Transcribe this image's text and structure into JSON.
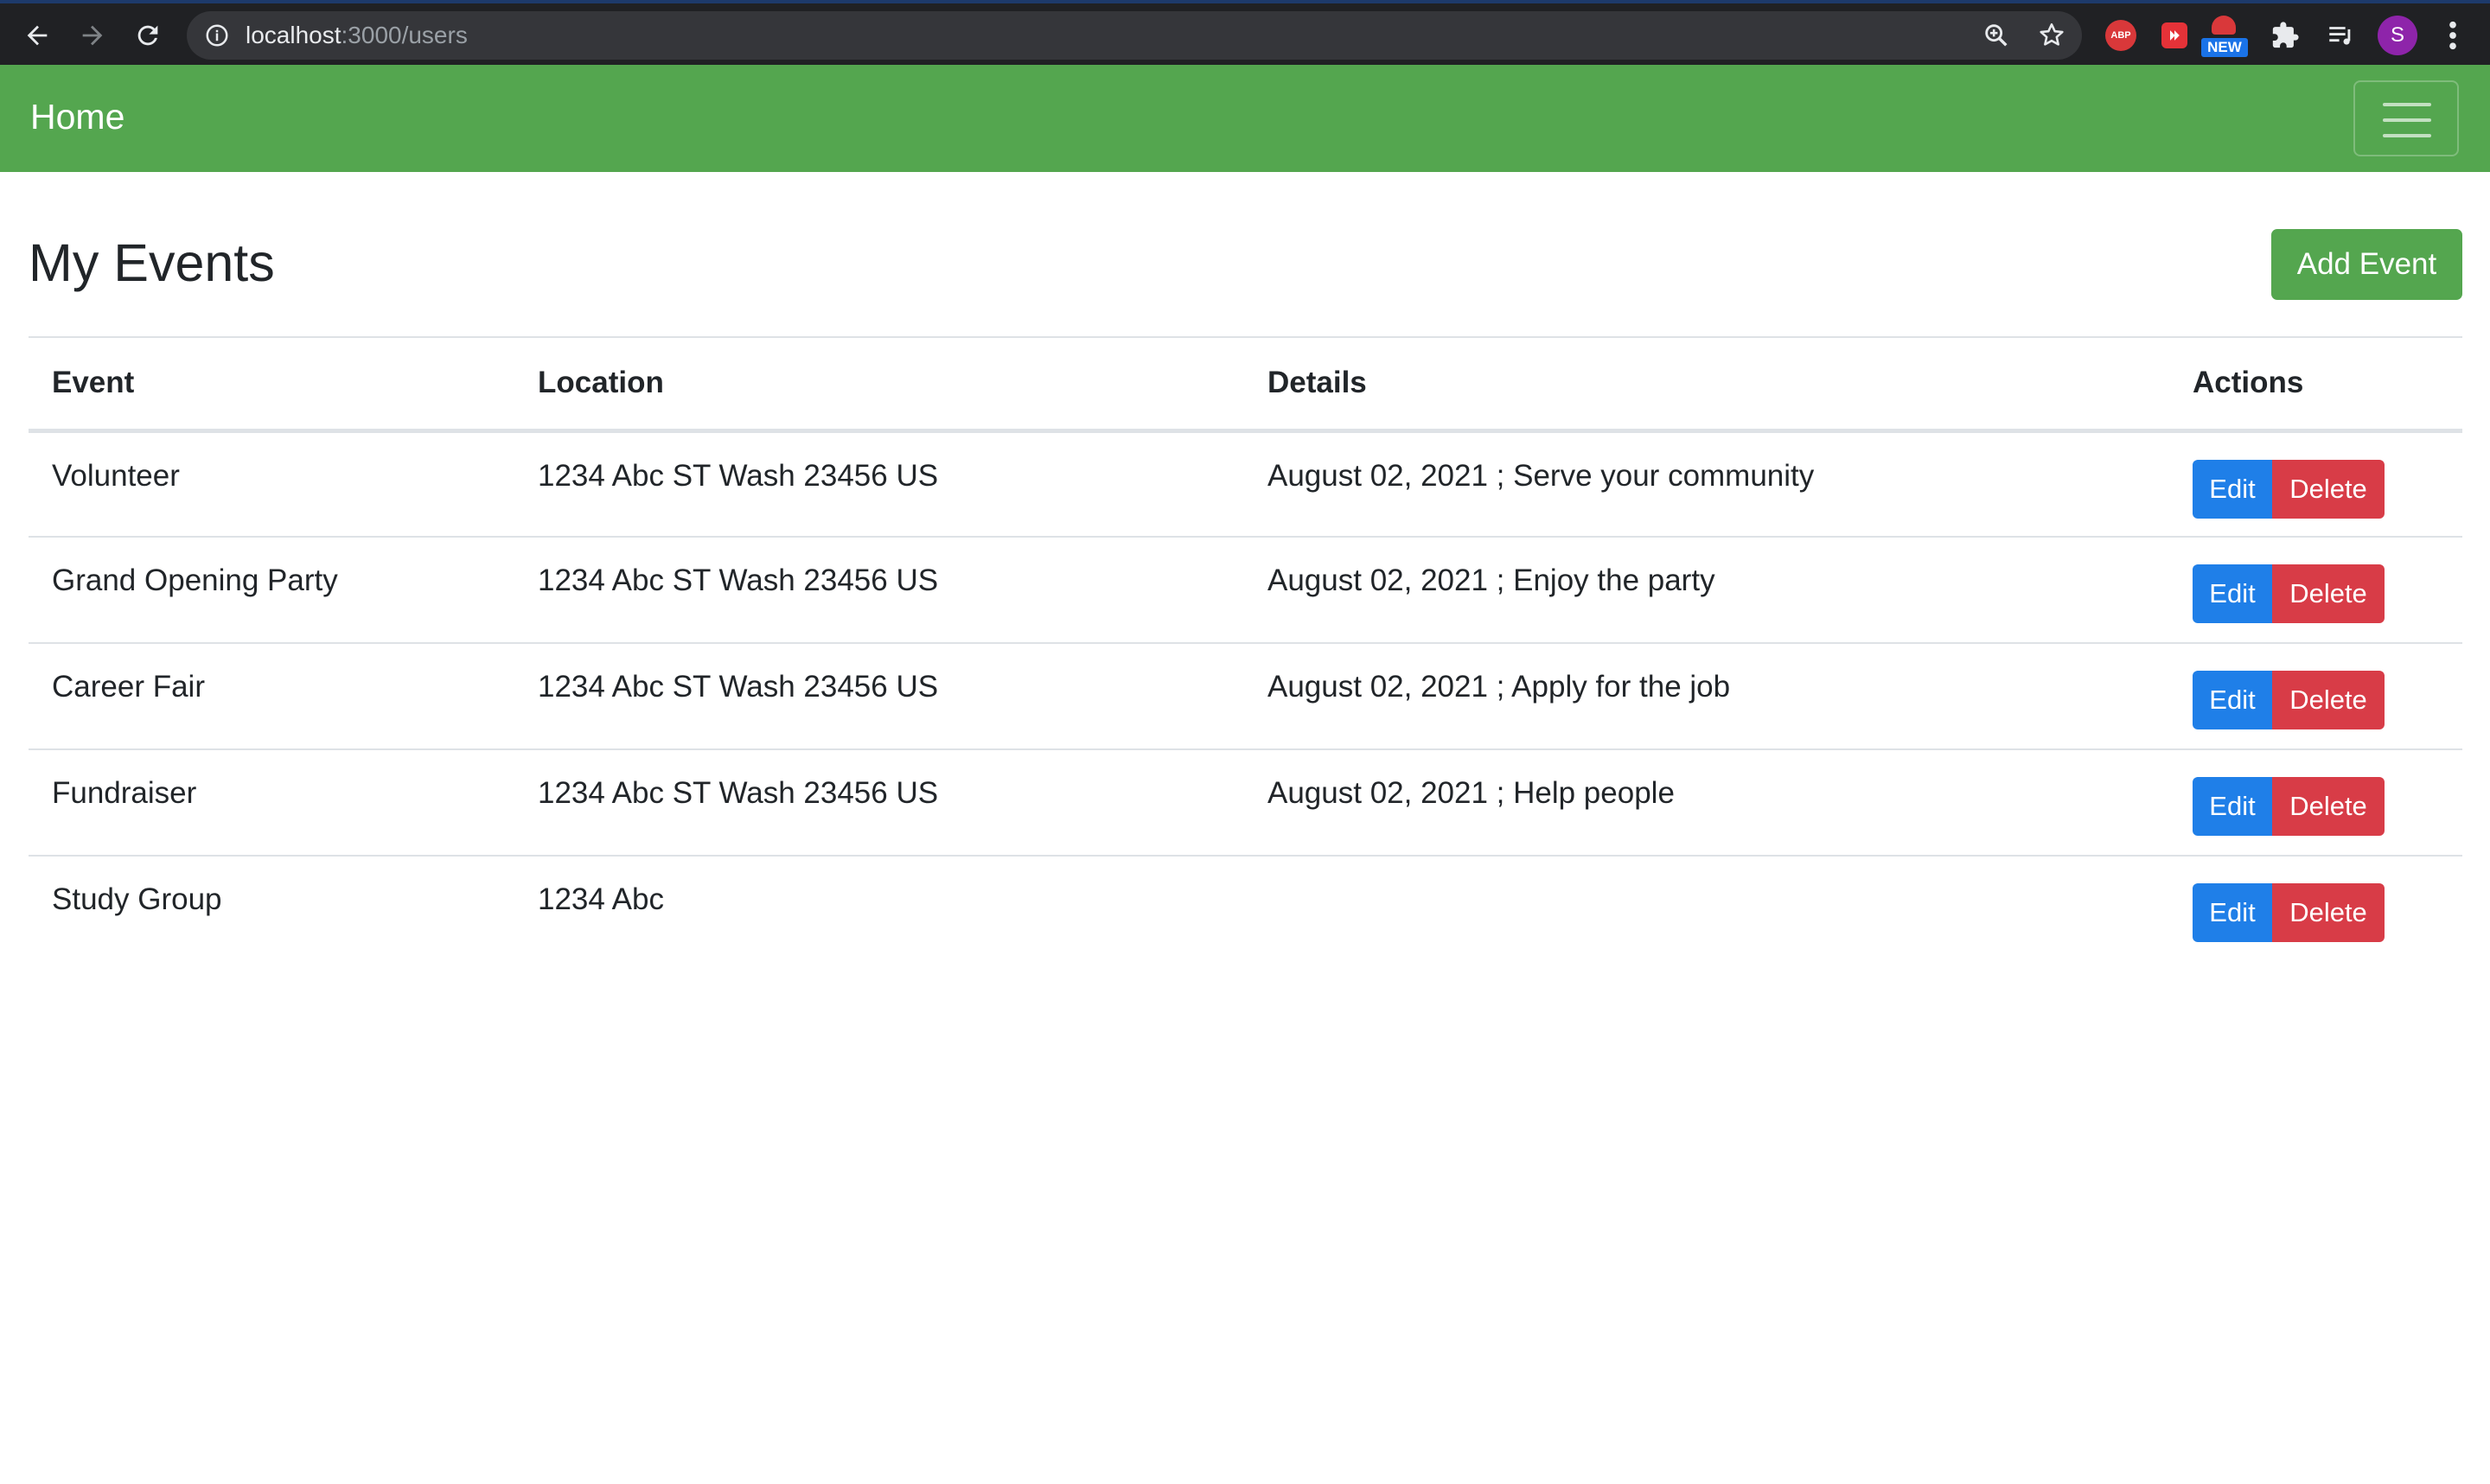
{
  "browser": {
    "url_host": "localhost",
    "url_path": ":3000/users",
    "new_badge": "NEW",
    "abp_label": "ABP",
    "profile_initial": "S"
  },
  "navbar": {
    "brand": "Home"
  },
  "main": {
    "title": "My Events",
    "add_button": "Add Event",
    "columns": [
      "Event",
      "Location",
      "Details",
      "Actions"
    ],
    "rows": [
      {
        "event": "Volunteer",
        "location": "1234 Abc ST Wash 23456 US",
        "details": "August 02, 2021 ; Serve your community"
      },
      {
        "event": "Grand Opening Party",
        "location": "1234 Abc ST Wash 23456 US",
        "details": "August 02, 2021 ; Enjoy the party"
      },
      {
        "event": "Career Fair",
        "location": "1234 Abc ST Wash 23456 US",
        "details": "August 02, 2021 ; Apply for the job"
      },
      {
        "event": "Fundraiser",
        "location": "1234 Abc ST Wash 23456 US",
        "details": "August 02, 2021 ; Help people"
      },
      {
        "event": "Study Group",
        "location": "1234 Abc",
        "details": ""
      }
    ],
    "edit_label": "Edit",
    "delete_label": "Delete"
  },
  "colors": {
    "navbar": "#54a64f",
    "edit": "#1f7fe8",
    "delete": "#d83c47"
  }
}
